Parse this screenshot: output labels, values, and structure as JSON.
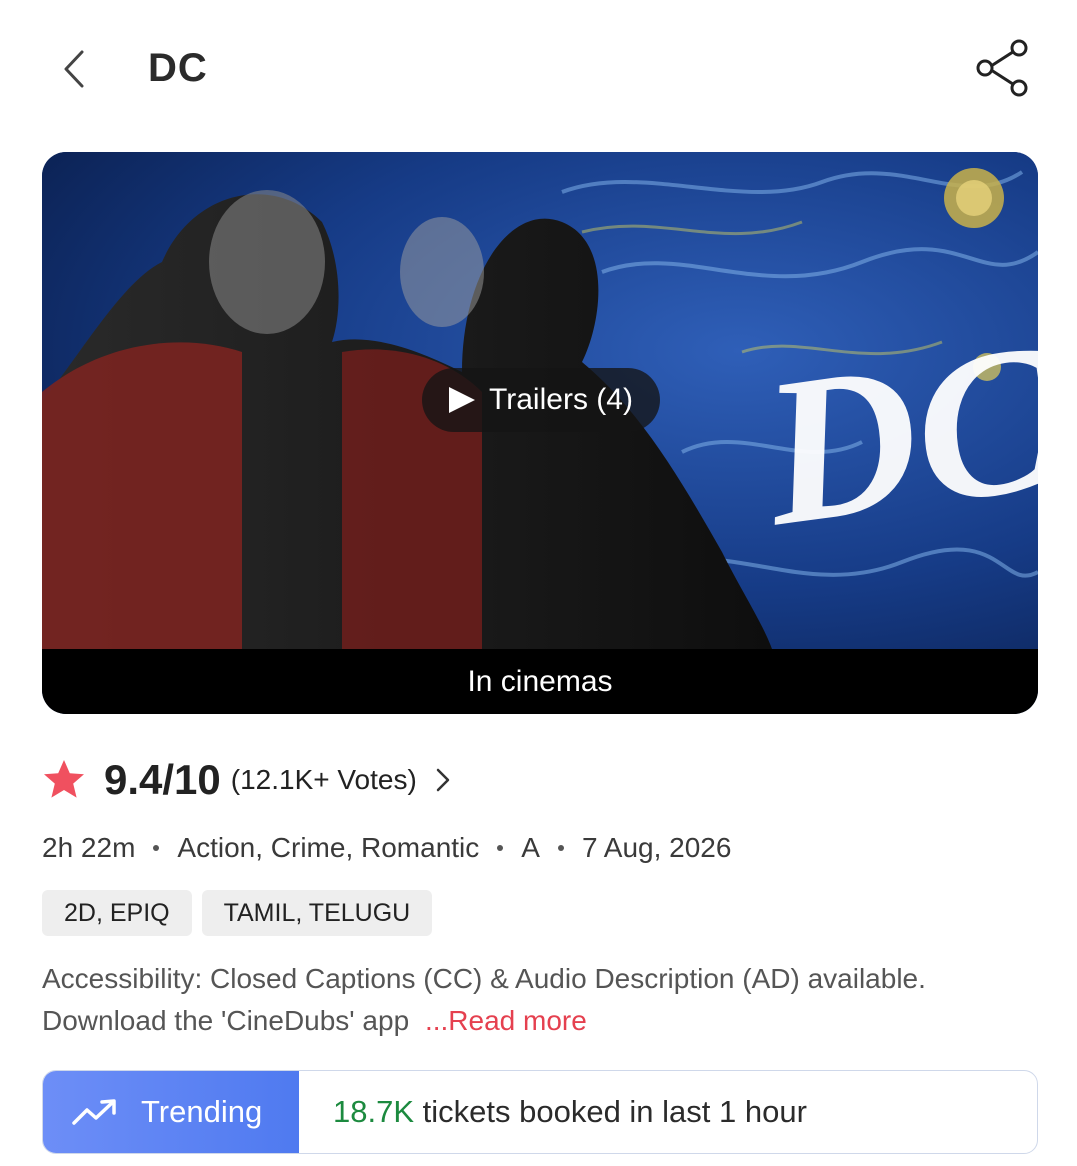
{
  "header": {
    "title": "DC",
    "back_icon": "chevron-left-icon",
    "share_icon": "share-icon"
  },
  "poster": {
    "logo_text": "DC",
    "trailer_label": "Trailers (4)",
    "footer_label": "In cinemas"
  },
  "rating": {
    "value": "9.4/10",
    "votes": "(12.1K+ Votes)",
    "star_color": "#f0505f"
  },
  "meta": {
    "duration": "2h 22m",
    "genres": "Action, Crime, Romantic",
    "certificate": "A",
    "release_date": "7 Aug, 2026"
  },
  "tags": [
    "2D, EPIQ",
    "TAMIL, TELUGU"
  ],
  "about": {
    "text": "Accessibility: Closed Captions (CC) & Audio Description (AD) available. Download the 'CineDubs' app",
    "read_more": "...Read more"
  },
  "trending": {
    "badge_label": "Trending",
    "count": "18.7K",
    "rest": "tickets booked in last 1 hour",
    "accent": "#5b82f4",
    "count_color": "#1c8a3f"
  }
}
